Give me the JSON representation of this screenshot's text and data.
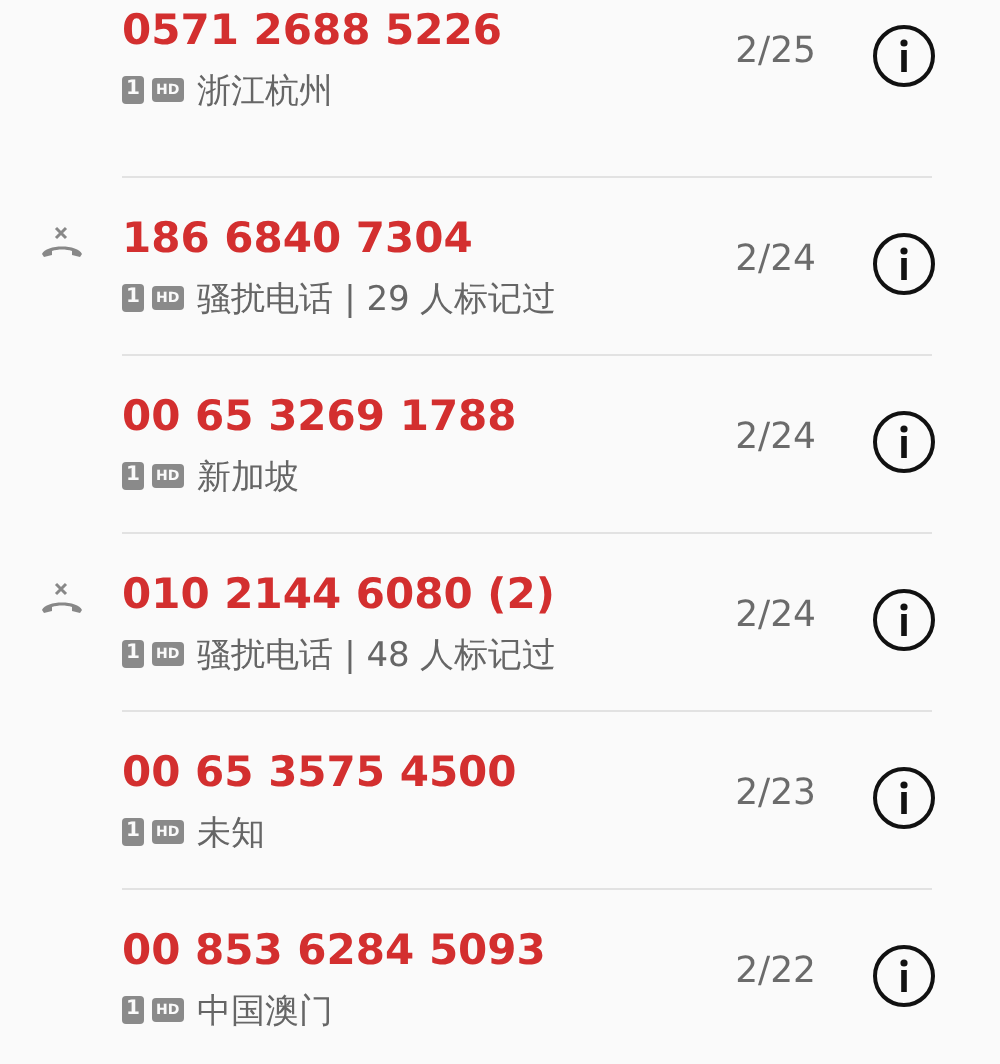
{
  "calls": [
    {
      "number": "0571 2688 5226",
      "sim": "1",
      "hd": "HD",
      "info": "浙江杭州",
      "date": "2/25",
      "blocked": false
    },
    {
      "number": "186 6840 7304",
      "sim": "1",
      "hd": "HD",
      "info": "骚扰电话 | 29 人标记过",
      "date": "2/24",
      "blocked": true
    },
    {
      "number": "00 65 3269 1788",
      "sim": "1",
      "hd": "HD",
      "info": "新加坡",
      "date": "2/24",
      "blocked": false
    },
    {
      "number": "010 2144 6080 (2)",
      "sim": "1",
      "hd": "HD",
      "info": "骚扰电话 | 48 人标记过",
      "date": "2/24",
      "blocked": true
    },
    {
      "number": "00 65 3575 4500",
      "sim": "1",
      "hd": "HD",
      "info": "未知",
      "date": "2/23",
      "blocked": false
    },
    {
      "number": "00 853 6284 5093",
      "sim": "1",
      "hd": "HD",
      "info": "中国澳门",
      "date": "2/22",
      "blocked": false
    }
  ]
}
